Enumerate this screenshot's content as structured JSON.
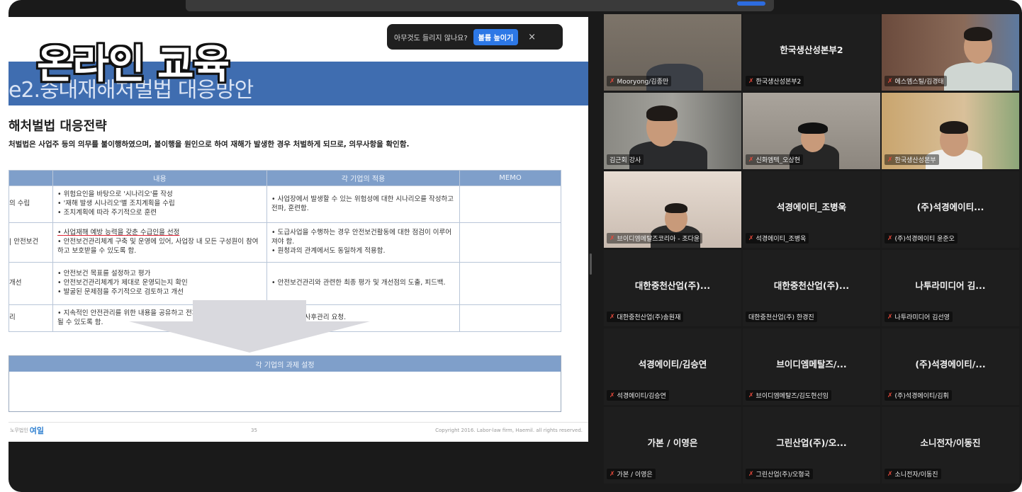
{
  "overlay": {
    "title": "온라인 교육"
  },
  "notification": {
    "text": "아무것도 들리지 않나요?",
    "button": "볼륨 높이기",
    "close": "×"
  },
  "slide": {
    "section_title": "e2.중대재해처벌법 대응방안",
    "heading": "해처벌법 대응전략",
    "subtitle": "처벌법은 사업주 등의 의무를 불이행하였으며, 불이행을 원인으로 하여 재해가 발생한 경우 처벌하게 되므로, 의무사항을 확인함.",
    "table": {
      "headers": [
        "",
        "내용",
        "각 기업의 적용",
        "MEMO"
      ],
      "rows": [
        {
          "label": "의 수립",
          "content": [
            "위험요인을 바탕으로 '시나리오'를 작성",
            "'재해 발생 시나리오'별 조치계획을 수립",
            "조치계획에 따라 주기적으로 훈련"
          ],
          "application": [
            "사업장에서 발생할 수 있는 위험성에 대한 시나리오를 작성하고 전파, 훈련함."
          ]
        },
        {
          "label": "| 안전보건",
          "content": [
            "사업재해 예방 능력을 갖춘 수급인을 선정",
            "안전보건관리체계 구축 및 운영에 있어, 사업장 내 모든 구성원이 참여하고 보호받을 수 있도록 함."
          ],
          "application": [
            "도급사업을 수행하는 경우 안전보건활동에 대한 점검이 이루어져야 함.",
            "원청과의 관계에서도 동일하게 적용함."
          ]
        },
        {
          "label": "개선",
          "content": [
            "안전보건 목표를 설정하고 평가",
            "안전보건관리체계가 제대로 운영되는지 확인",
            "발굴된 문제점을 주기적으로 검토하고 개선"
          ],
          "application": [
            "안전보건관리와 관련한 최종 평가 및 개선점의 도출, 피드백."
          ]
        },
        {
          "label": "리",
          "content": [
            "지속적인 안전관리를 위한 내용을 공유하고 전파하여 일상생활에 전이 될 수 있도록 함."
          ],
          "application": [
            "지속적인 사후관리 요청."
          ]
        }
      ]
    },
    "task_header": "각 기업의 과제 설정",
    "footer": {
      "brand": "노무법인",
      "logo": "여일",
      "page": "35",
      "copyright": "Copyright 2016. Labor-law firm, Haemil. all rights reserved."
    }
  },
  "participants": [
    {
      "display": "",
      "caption": "Mooryong/김종만",
      "muted": true,
      "video": true
    },
    {
      "display": "한국생산성본부2",
      "caption": "한국생산성본부2",
      "muted": true,
      "video": false
    },
    {
      "display": "",
      "caption": "에스엠스틸/김경태",
      "muted": true,
      "video": true
    },
    {
      "display": "",
      "caption": "김근회 강사",
      "muted": false,
      "video": true,
      "active": true
    },
    {
      "display": "",
      "caption": "신화엠텍_오상현",
      "muted": true,
      "video": true
    },
    {
      "display": "",
      "caption": "한국생산성본부",
      "muted": true,
      "video": true
    },
    {
      "display": "",
      "caption": "브이디엠메탈즈코리아 - 조다윤",
      "muted": true,
      "video": true
    },
    {
      "display": "석경에이티_조병욱",
      "caption": "석경에이티_조병욱",
      "muted": true,
      "video": false
    },
    {
      "display": "(주)석경에이티...",
      "caption": "(주)석경에이티 윤준오",
      "muted": true,
      "video": false
    },
    {
      "display": "대한중천산업(주)...",
      "caption": "대한중천산업(주)송원재",
      "muted": true,
      "video": false
    },
    {
      "display": "대한중천산업(주)...",
      "caption": "대한중천산업(주) 한경진",
      "muted": false,
      "video": false
    },
    {
      "display": "나투라미디어 김...",
      "caption": "나투라미디어 김선영",
      "muted": true,
      "video": false
    },
    {
      "display": "석경에이티/김승연",
      "caption": "석경에이티/김승연",
      "muted": true,
      "video": false
    },
    {
      "display": "브이디엠메탈즈/...",
      "caption": "브이디엠메탈즈/김도현선임",
      "muted": true,
      "video": false
    },
    {
      "display": "(주)석경에이티/...",
      "caption": "(주)석경에이티/김휘",
      "muted": true,
      "video": false
    },
    {
      "display": "가본 / 이영은",
      "caption": "가본 / 이영은",
      "muted": true,
      "video": false
    },
    {
      "display": "그린산업(주)/오...",
      "caption": "그린산업(주)/오형국",
      "muted": true,
      "video": false
    },
    {
      "display": "소니전자/이동진",
      "caption": "소니전자/이동진",
      "muted": true,
      "video": false
    }
  ],
  "icons": {
    "mic_muted": "mic-muted-icon",
    "close": "close-icon"
  },
  "colors": {
    "active_speaker": "#35c56b",
    "slide_banner": "#3f6db0",
    "notif_button": "#2d78e6"
  }
}
